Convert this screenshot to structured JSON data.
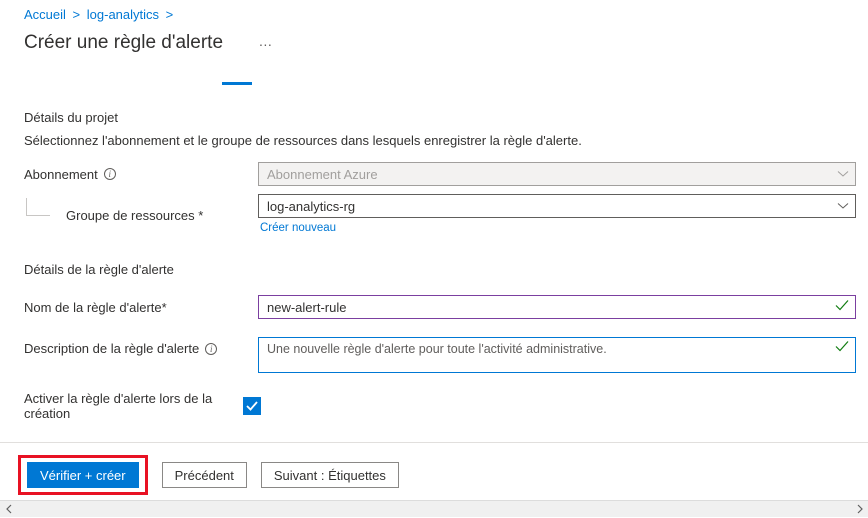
{
  "breadcrumb": {
    "home": "Accueil",
    "item": "log-analytics"
  },
  "page_title": "Créer une règle d'alerte",
  "project_details": {
    "title": "Détails du projet",
    "desc": "Sélectionnez l'abonnement et le groupe de ressources dans lesquels enregistrer la règle d'alerte.",
    "subscription_label": "Abonnement",
    "subscription_value": "Abonnement Azure",
    "rg_label": "Groupe de ressources *",
    "rg_value": "log-analytics-rg",
    "create_new": "Créer nouveau"
  },
  "rule_details": {
    "title": "Détails de la règle d'alerte",
    "name_label": "Nom de la règle d'alerte*",
    "name_value": "new-alert-rule",
    "desc_label": "Description de la règle d'alerte",
    "desc_value": "Une nouvelle règle d'alerte pour toute l'activité administrative.",
    "enable_label": "Activer la règle d'alerte lors de la création",
    "enable_checked": true
  },
  "footer": {
    "verify_create": "Vérifier + créer",
    "previous": "Précédent",
    "next": "Suivant : Étiquettes"
  }
}
